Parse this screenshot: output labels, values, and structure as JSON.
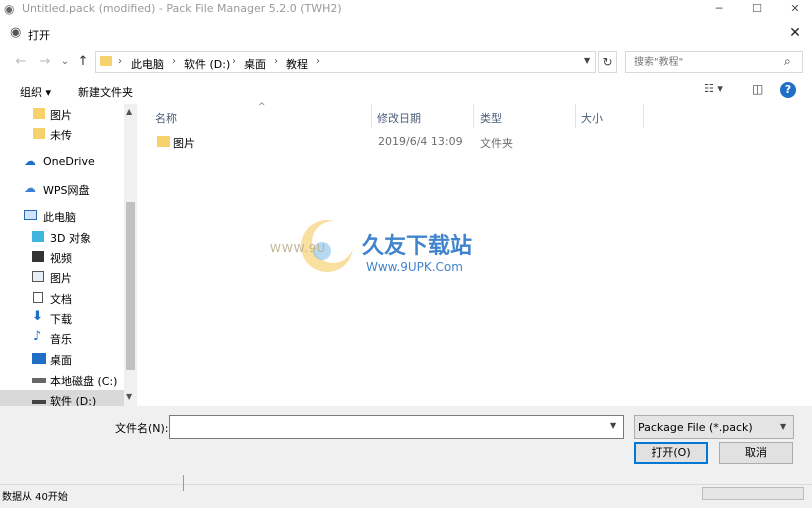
{
  "outer_window": {
    "title": "Untitled.pack (modified) - Pack File Manager 5.2.0 (TWH2)",
    "minimize": "─",
    "maximize": "☐",
    "close": "✕"
  },
  "dialog": {
    "title": "打开",
    "close": "✕"
  },
  "nav": {
    "back": "←",
    "forward": "→",
    "recent": "⌄",
    "up": "↑",
    "refresh": "↻"
  },
  "address": {
    "crumbs": [
      "此电脑",
      "软件 (D:)",
      "桌面",
      "教程"
    ],
    "sep": "›"
  },
  "search": {
    "placeholder": "搜索\"教程\"",
    "icon": "search-icon"
  },
  "toolbar": {
    "organize": "组织 ▾",
    "new_folder": "新建文件夹",
    "view": "☷ ▾",
    "pane": "◫",
    "help": "?"
  },
  "sidebar": {
    "items": [
      {
        "label": "图片",
        "icon": "folder-icon"
      },
      {
        "label": "未传",
        "icon": "folder-icon"
      },
      {
        "label": "OneDrive",
        "icon": "cloud-icon"
      },
      {
        "label": "WPS网盘",
        "icon": "cloud-icon"
      },
      {
        "label": "此电脑",
        "icon": "computer-icon"
      },
      {
        "label": "3D 对象",
        "icon": "cube-icon"
      },
      {
        "label": "视频",
        "icon": "video-icon"
      },
      {
        "label": "图片",
        "icon": "picture-icon"
      },
      {
        "label": "文档",
        "icon": "document-icon"
      },
      {
        "label": "下载",
        "icon": "download-icon"
      },
      {
        "label": "音乐",
        "icon": "music-icon"
      },
      {
        "label": "桌面",
        "icon": "desktop-icon"
      },
      {
        "label": "本地磁盘 (C:)",
        "icon": "drive-icon"
      },
      {
        "label": "软件 (D:)",
        "icon": "drive-icon"
      }
    ],
    "selected": "软件 (D:)"
  },
  "columns": [
    "名称",
    "修改日期",
    "类型",
    "大小"
  ],
  "files": [
    {
      "name": "图片",
      "modified": "2019/6/4 13:09",
      "type": "文件夹",
      "size": ""
    }
  ],
  "watermark": {
    "url_left": "WWW.9U",
    "brand": "久友下载站",
    "url": "Www.9UPK.Com"
  },
  "filename": {
    "label": "文件名(N):",
    "value": ""
  },
  "filter": {
    "value": "Package File (*.pack)"
  },
  "buttons": {
    "open": "打开(O)",
    "cancel": "取消"
  },
  "status": {
    "text": "数据从 40开始"
  },
  "colors": {
    "accent": "#0078d7",
    "folder": "#f7d26c",
    "selected_bg": "#d9d9d9"
  }
}
